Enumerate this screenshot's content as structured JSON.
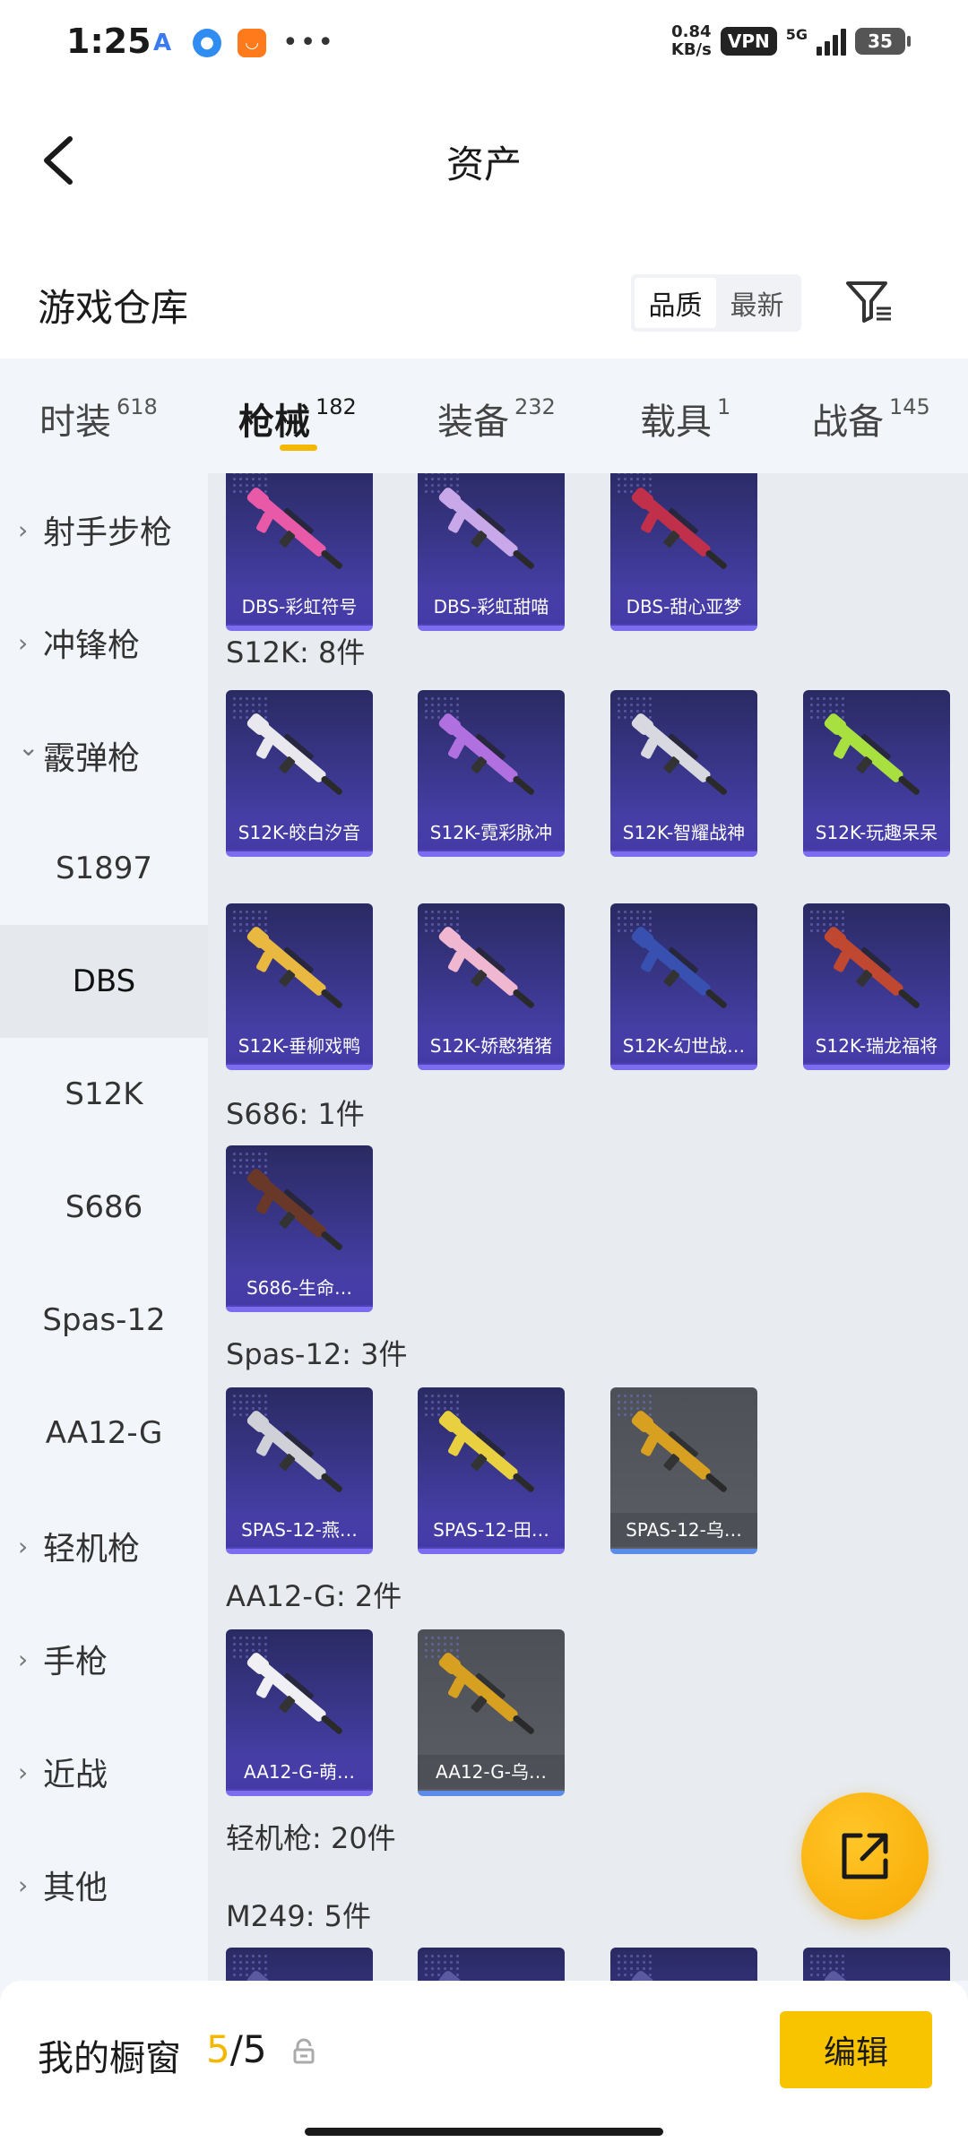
{
  "status_bar": {
    "time": "1:25",
    "net_speed_value": "0.84",
    "net_speed_unit": "KB/s",
    "vpn": "VPN",
    "network": "5G",
    "battery": "35"
  },
  "header": {
    "title": "资产"
  },
  "warehouse": {
    "title": "游戏仓库",
    "sort_options": [
      "品质",
      "最新"
    ],
    "active_sort": "品质"
  },
  "tabs": [
    {
      "label": "时装",
      "count": "618"
    },
    {
      "label": "枪械",
      "count": "182",
      "active": true
    },
    {
      "label": "装备",
      "count": "232"
    },
    {
      "label": "载具",
      "count": "1"
    },
    {
      "label": "战备",
      "count": "145"
    }
  ],
  "sidebar": [
    {
      "label": "射手步枪",
      "type": "group"
    },
    {
      "label": "冲锋枪",
      "type": "group"
    },
    {
      "label": "霰弹枪",
      "type": "group",
      "expanded": true
    },
    {
      "label": "S1897",
      "type": "sub"
    },
    {
      "label": "DBS",
      "type": "sub",
      "active": true
    },
    {
      "label": "S12K",
      "type": "sub"
    },
    {
      "label": "S686",
      "type": "sub"
    },
    {
      "label": "Spas-12",
      "type": "sub"
    },
    {
      "label": "AA12-G",
      "type": "sub"
    },
    {
      "label": "轻机枪",
      "type": "group"
    },
    {
      "label": "手枪",
      "type": "group"
    },
    {
      "label": "近战",
      "type": "group"
    },
    {
      "label": "其他",
      "type": "group"
    }
  ],
  "sections": [
    {
      "label": "",
      "items": [
        {
          "name": "DBS-彩虹符号",
          "color": "#e85aa8",
          "style": "purple"
        },
        {
          "name": "DBS-彩虹甜喵",
          "color": "#c8a8e8",
          "style": "purple"
        },
        {
          "name": "DBS-甜心亚梦",
          "color": "#c0304a",
          "style": "purple"
        }
      ]
    },
    {
      "label": "S12K: 8件",
      "items": [
        {
          "name": "S12K-皎白汐音",
          "color": "#e8e8ee",
          "style": "purple"
        },
        {
          "name": "S12K-霓彩脉冲",
          "color": "#b070e0",
          "style": "purple"
        },
        {
          "name": "S12K-智耀战神",
          "color": "#d8d8e0",
          "style": "purple"
        },
        {
          "name": "S12K-玩趣呆呆",
          "color": "#a8e040",
          "style": "purple"
        },
        {
          "name": "S12K-垂柳戏鸭",
          "color": "#e8b840",
          "style": "purple"
        },
        {
          "name": "S12K-娇憨猪猪",
          "color": "#f0b8d0",
          "style": "purple"
        },
        {
          "name": "S12K-幻世战…",
          "color": "#3850b0",
          "style": "purple"
        },
        {
          "name": "S12K-瑞龙福将",
          "color": "#c04830",
          "style": "purple"
        }
      ]
    },
    {
      "label": "S686: 1件",
      "items": [
        {
          "name": "S686-生命…",
          "color": "#6a3828",
          "style": "purple"
        }
      ]
    },
    {
      "label": "Spas-12: 3件",
      "items": [
        {
          "name": "SPAS-12-燕…",
          "color": "#d0d0d8",
          "style": "purple"
        },
        {
          "name": "SPAS-12-田…",
          "color": "#e8d040",
          "style": "purple"
        },
        {
          "name": "SPAS-12-乌…",
          "color": "#d8a020",
          "style": "gray"
        }
      ]
    },
    {
      "label": "AA12-G: 2件",
      "items": [
        {
          "name": "AA12-G-萌…",
          "color": "#f0f0f4",
          "style": "purple"
        },
        {
          "name": "AA12-G-乌…",
          "color": "#d8a020",
          "style": "gray"
        }
      ]
    },
    {
      "label": "轻机枪: 20件",
      "items": []
    },
    {
      "label": "M249: 5件",
      "items": [
        {
          "name": "",
          "color": "#5a5aa0",
          "style": "purple"
        },
        {
          "name": "",
          "color": "#5a5aa0",
          "style": "purple"
        },
        {
          "name": "",
          "color": "#5a5aa0",
          "style": "purple"
        },
        {
          "name": "",
          "color": "#5a5aa0",
          "style": "purple"
        }
      ]
    }
  ],
  "bottom": {
    "showcase_label": "我的橱窗",
    "showcase_current": "5",
    "showcase_sep": "/",
    "showcase_total": "5",
    "edit_label": "编辑"
  },
  "icons": {
    "back": "chevron-left-icon",
    "filter": "filter-icon",
    "share": "share-external-icon",
    "lock": "lock-icon"
  }
}
